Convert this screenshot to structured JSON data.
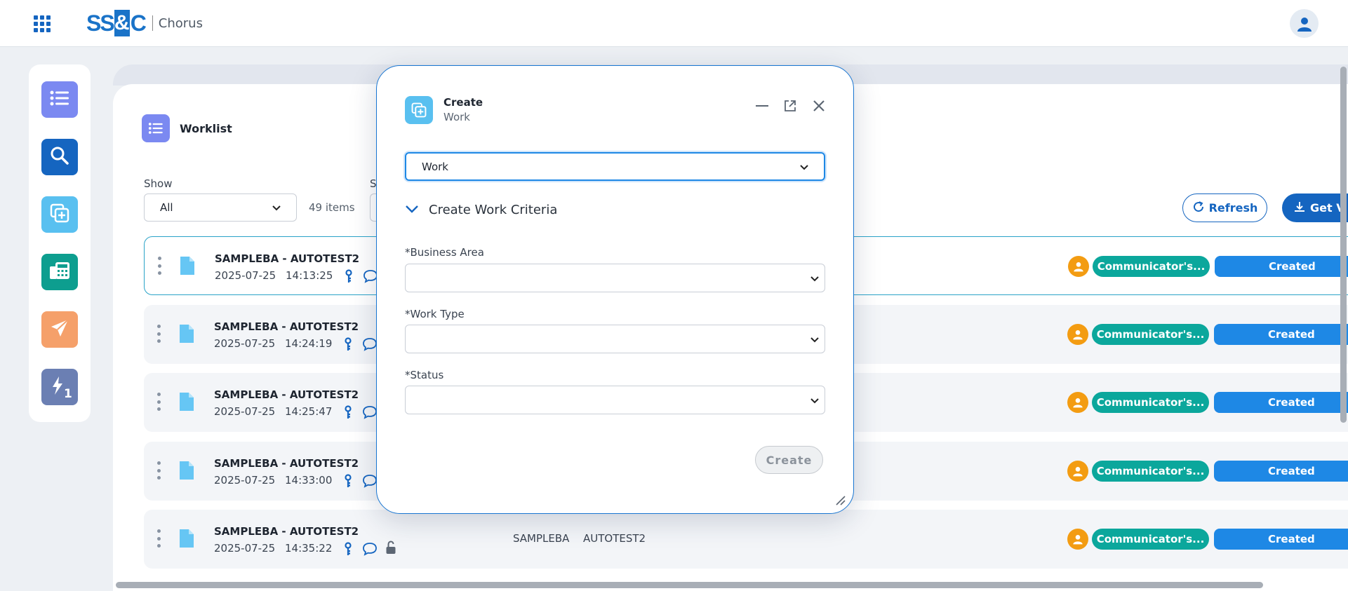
{
  "header": {
    "brand": {
      "ss": "SS",
      "amp": "&",
      "c": "C"
    },
    "app_name": "Chorus",
    "apps_icon": "grid-icon",
    "user_icon": "user-icon"
  },
  "rail": {
    "items": [
      {
        "icon": "list-icon",
        "color": "#7b89f1"
      },
      {
        "icon": "search-icon",
        "color": "#1565c0"
      },
      {
        "icon": "create-copy-icon",
        "color": "#59c0f0"
      },
      {
        "icon": "document-calculator-icon",
        "color": "#0d9e8f"
      },
      {
        "icon": "send-icon",
        "color": "#f5a06a"
      },
      {
        "icon": "quick-action-icon",
        "color": "#6b7fb3"
      }
    ],
    "quick_badge": "1"
  },
  "worklist": {
    "title": "Worklist",
    "show_label": "Show",
    "show_value": "All",
    "sort_label": "S",
    "items_count": "49 items",
    "refresh_label": "Refresh",
    "get_label": "Get V",
    "rows": [
      {
        "title": "SAMPLEBA - AUTOTEST2",
        "date": "2025-07-25",
        "time": "14:13:25",
        "col1": "",
        "col2": "",
        "comm": "Communicator's...",
        "status": "Created"
      },
      {
        "title": "SAMPLEBA - AUTOTEST2",
        "date": "2025-07-25",
        "time": "14:24:19",
        "col1": "",
        "col2": "",
        "comm": "Communicator's...",
        "status": "Created"
      },
      {
        "title": "SAMPLEBA - AUTOTEST2",
        "date": "2025-07-25",
        "time": "14:25:47",
        "col1": "",
        "col2": "",
        "comm": "Communicator's...",
        "status": "Created"
      },
      {
        "title": "SAMPLEBA - AUTOTEST2",
        "date": "2025-07-25",
        "time": "14:33:00",
        "col1": "",
        "col2": "",
        "comm": "Communicator's...",
        "status": "Created"
      },
      {
        "title": "SAMPLEBA - AUTOTEST2",
        "date": "2025-07-25",
        "time": "14:35:22",
        "col1": "SAMPLEBA",
        "col2": "AUTOTEST2",
        "comm": "Communicator's...",
        "status": "Created"
      }
    ]
  },
  "dialog": {
    "title": "Create",
    "subtitle": "Work",
    "type_value": "Work",
    "criteria_label": "Create Work Criteria",
    "business_area_label": "*Business Area",
    "business_area_value": "",
    "work_type_label": "*Work Type",
    "work_type_value": "",
    "status_label": "*Status",
    "status_value": "",
    "create_label": "Create"
  },
  "colors": {
    "accent": "#1565c0",
    "teal_pill": "#0ba79c",
    "status_pill": "#1e88e5",
    "person": "#f39c12"
  }
}
